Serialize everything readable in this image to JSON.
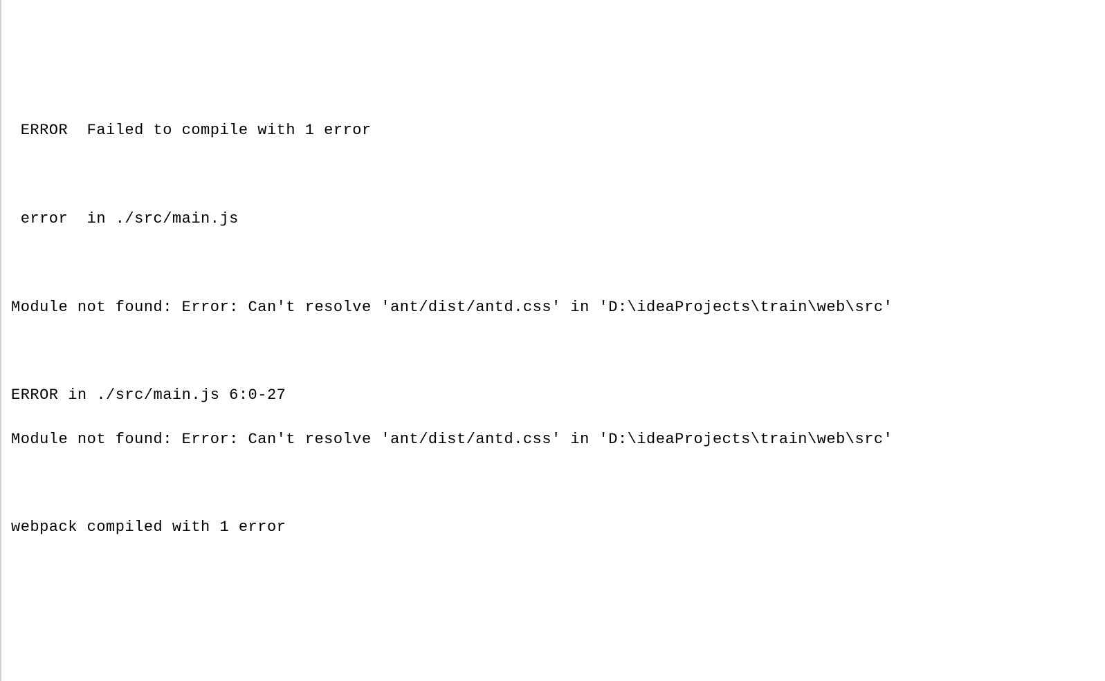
{
  "terminal": {
    "lines": [
      " ERROR  Failed to compile with 1 error",
      "",
      " error  in ./src/main.js",
      "",
      "Module not found: Error: Can't resolve 'ant/dist/antd.css' in 'D:\\ideaProjects\\train\\web\\src'",
      "",
      "ERROR in ./src/main.js 6:0-27",
      "Module not found: Error: Can't resolve 'ant/dist/antd.css' in 'D:\\ideaProjects\\train\\web\\src'",
      "",
      "webpack compiled with 1 error"
    ]
  }
}
